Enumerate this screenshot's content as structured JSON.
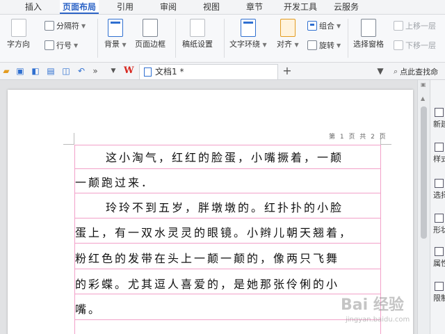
{
  "tabs": [
    "插入",
    "页面布局",
    "引用",
    "审阅",
    "视图",
    "章节",
    "开发工具",
    "云服务"
  ],
  "active_tab": "页面布局",
  "ribbon": {
    "text_direction": "字方向",
    "separator": "分隔符",
    "line_number": "行号",
    "background": "背景",
    "page_border": "页面边框",
    "draft_settings": "稿纸设置",
    "text_wrap": "文字环绕",
    "align": "对齐",
    "group": "组合",
    "rotate": "旋转",
    "selection_pane": "选择窗格",
    "bring_forward": "上移一层",
    "send_backward": "下移一层"
  },
  "toolbar": {
    "doc_tab_title": "文档1 *",
    "add_tab": "+",
    "search_label": "点此查找命"
  },
  "document": {
    "header_page_info": "第 1 页 共 2 页",
    "lines": [
      "这小淘气，红红的脸蛋，小嘴撅着，一颠",
      "一颠跑过来．",
      "玲玲不到五岁，胖墩墩的。红扑扑的小脸",
      "蛋上，有一双水灵灵的眼镜。小辫儿朝天翘着，",
      "粉红色的发带在头上一颠一颠的，像两只飞舞",
      "的彩蝶。尤其逗人喜爱的，是她那张伶俐的小",
      "嘴。"
    ]
  },
  "side_panel": [
    "新建",
    "样式",
    "选择",
    "形状",
    "属性",
    "限制"
  ],
  "watermark": {
    "text": "Bai 经验",
    "url": "jingyan.baidu.com"
  },
  "colors": {
    "accent": "#2b63c6",
    "grid": "#f2a0c8",
    "wps_red": "#d7261e"
  }
}
